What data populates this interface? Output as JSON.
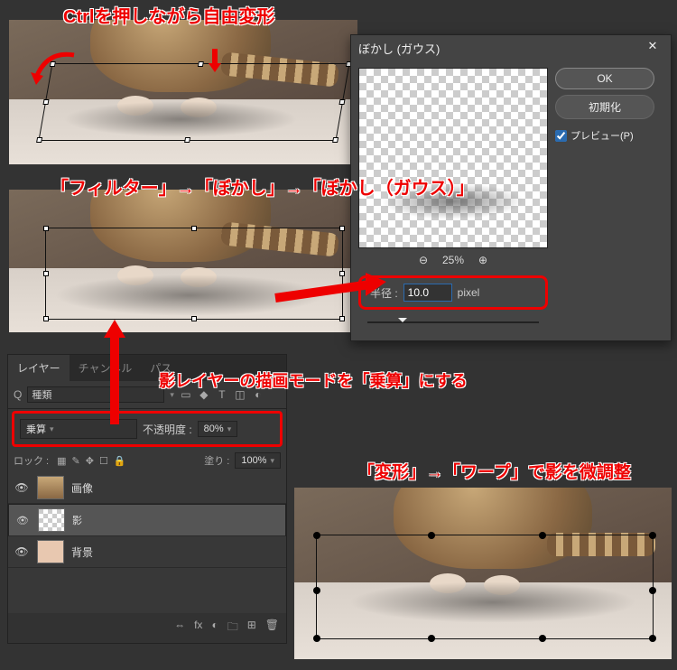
{
  "annotations": {
    "top": "Ctrlを押しながら自由変形",
    "filter_path": "「フィルター」→「ぼかし」→「ぼかし（ガウス）」",
    "blend_note": "影レイヤーの描画モードを「乗算」にする",
    "warp_note": "「変形」→「ワープ」で影を微調整"
  },
  "dialog": {
    "title": "ぼかし (ガウス)",
    "ok": "OK",
    "reset": "初期化",
    "preview_label": "プレビュー(P)",
    "zoom_pct": "25%",
    "radius_label": "半径 :",
    "radius_value": "10.0",
    "radius_unit": "pixel"
  },
  "layers_panel": {
    "tabs": {
      "layer": "レイヤー",
      "channel": "チャンネル",
      "path": "パス"
    },
    "filter_placeholder": "種類",
    "blend_mode": "乗算",
    "opacity_label": "不透明度 :",
    "opacity_value": "80%",
    "lock_label": "ロック :",
    "fill_label": "塗り :",
    "fill_value": "100%",
    "layers": [
      {
        "name": "画像"
      },
      {
        "name": "影"
      },
      {
        "name": "背景"
      }
    ],
    "bottom_fx": "fx"
  }
}
